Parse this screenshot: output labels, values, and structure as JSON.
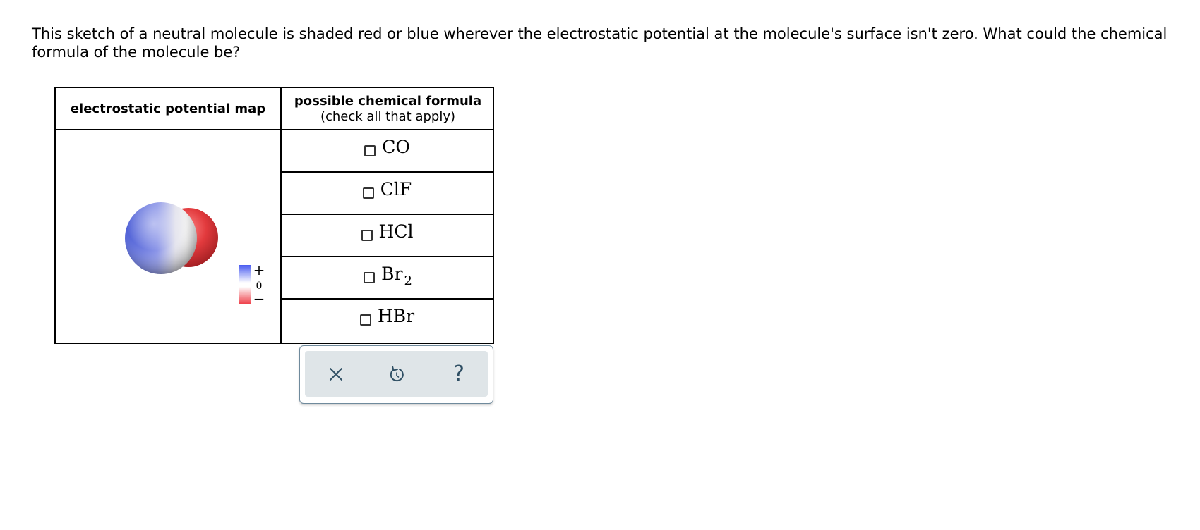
{
  "question": {
    "text": "This sketch of a neutral molecule is shaded red or blue wherever the electrostatic potential at the molecule's surface isn't zero. What could the chemical formula of the molecule be?"
  },
  "table": {
    "col_map_header": "electrostatic potential map",
    "col_formula_header": "possible chemical formula",
    "col_formula_subheader": "(check all that apply)",
    "legend": {
      "plus": "+",
      "zero": "0",
      "minus": "−"
    },
    "options": [
      {
        "formula": "CO",
        "subscript": "",
        "checked": false
      },
      {
        "formula": "ClF",
        "subscript": "",
        "checked": false
      },
      {
        "formula": "HCl",
        "subscript": "",
        "checked": false
      },
      {
        "formula": "Br",
        "subscript": "2",
        "checked": false
      },
      {
        "formula": "HBr",
        "subscript": "",
        "checked": false
      }
    ]
  },
  "toolbar": {
    "close_icon": "x-icon",
    "undo_icon": "undo-icon",
    "help_icon": "help-icon",
    "help_label": "?"
  },
  "colors": {
    "positive": "#5566e0",
    "negative": "#e03a40",
    "toolbar_icon": "#2f4f64",
    "toolbar_bg": "#dfe5e8"
  }
}
